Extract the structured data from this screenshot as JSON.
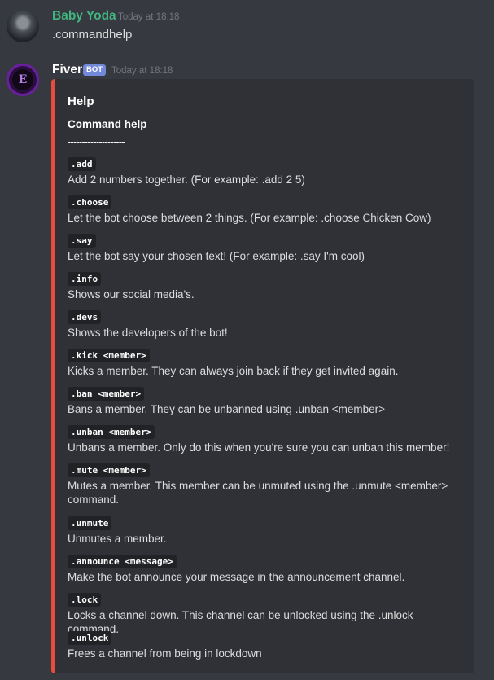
{
  "messages": [
    {
      "author": "Baby Yoda",
      "author_color": "#43b581",
      "timestamp": "Today at 18:18",
      "text": ".commandhelp"
    },
    {
      "author": "Fiver",
      "author_color": "#ffffff",
      "badge": "BOT",
      "timestamp": "Today at 18:18",
      "avatar_letter": "E"
    }
  ],
  "embed": {
    "accent_color": "#e74c3c",
    "title": "Help",
    "subtitle": "Command help",
    "rule": "--------------------",
    "commands": [
      {
        "cmd": ".add",
        "desc": "Add 2 numbers together. (For example: .add 2 5)"
      },
      {
        "cmd": ".choose",
        "desc": "Let the bot choose between 2 things. (For example: .choose Chicken Cow)"
      },
      {
        "cmd": ".say",
        "desc": "Let the bot say your chosen text! (For example: .say I'm cool)"
      },
      {
        "cmd": ".info",
        "desc": "Shows our social media's."
      },
      {
        "cmd": ".devs",
        "desc": "Shows the developers of the bot!"
      },
      {
        "cmd": ".kick <member>",
        "desc": "Kicks a member. They can always join back if they get invited again."
      },
      {
        "cmd": ".ban <member>",
        "desc": "Bans a member. They can be unbanned using .unban <member>"
      },
      {
        "cmd": ".unban <member>",
        "desc": "Unbans a member. Only do this when you're sure you can unban this member!"
      },
      {
        "cmd": ".mute <member>",
        "desc": "Mutes a member. This member can be unmuted using the .unmute <member> command."
      },
      {
        "cmd": ".unmute",
        "desc": "Unmutes a member."
      },
      {
        "cmd": ".announce <message>",
        "desc": "Make the bot announce your message in the announcement channel."
      },
      {
        "cmd": ".lock",
        "desc": "Locks a channel down. This channel can be unlocked using the .unlock command."
      },
      {
        "cmd": ".unlock",
        "desc": "Frees a channel from being in lockdown"
      }
    ]
  }
}
